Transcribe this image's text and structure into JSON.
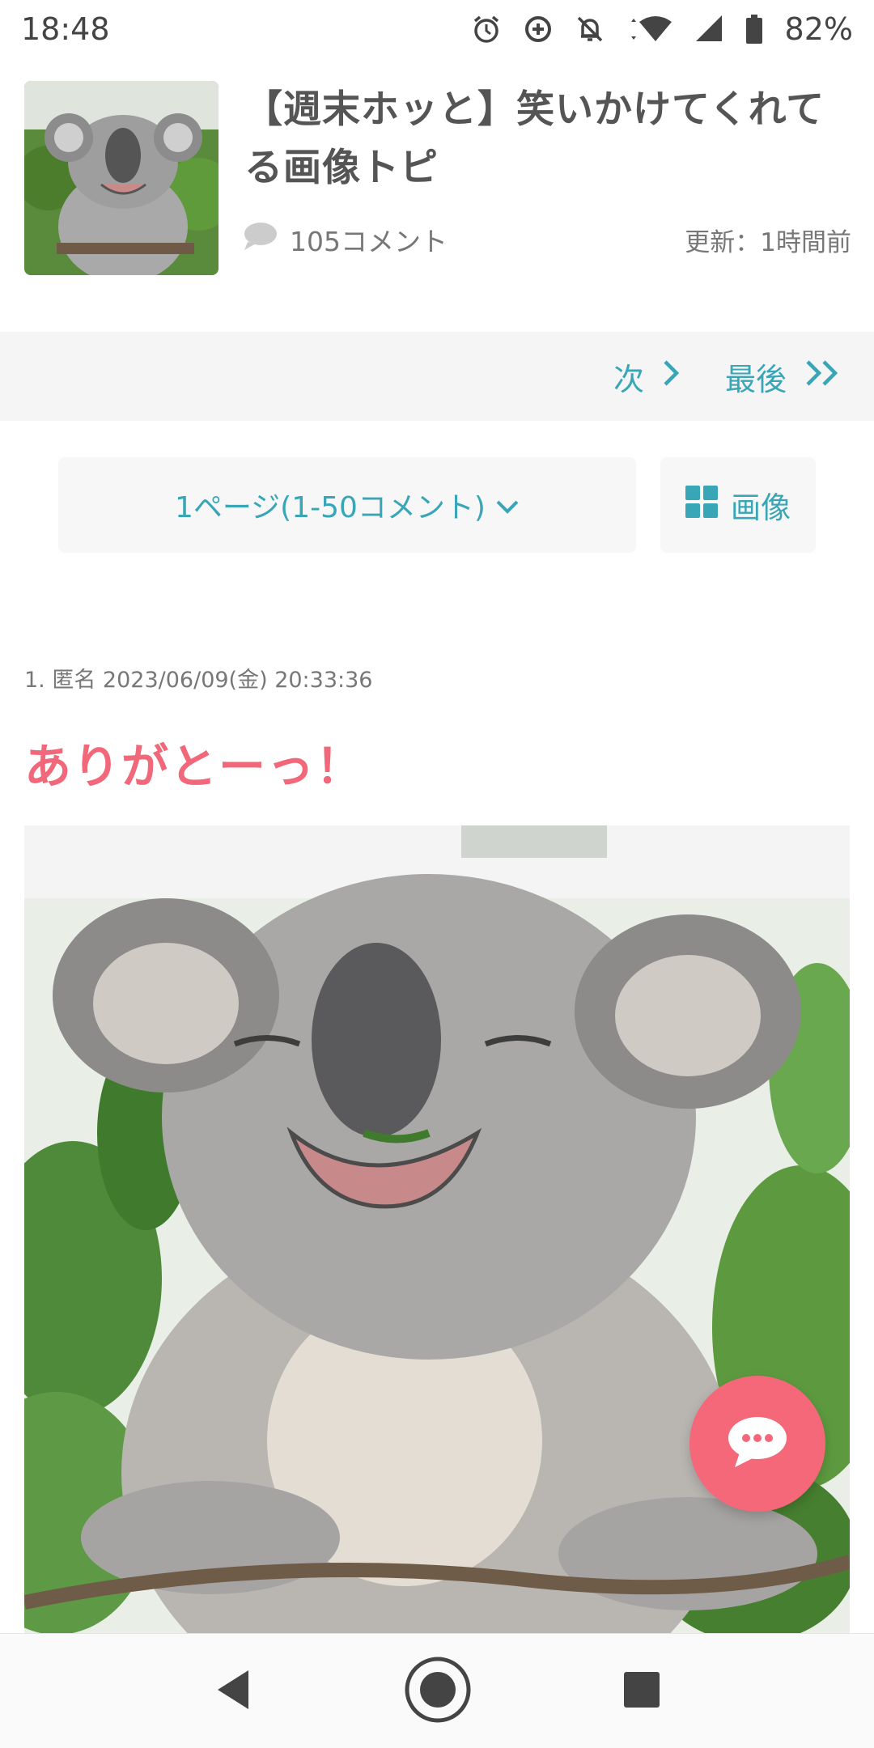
{
  "status_bar": {
    "time": "18:48",
    "battery": "82%",
    "icons": [
      "alarm-icon",
      "data-saver-icon",
      "mute-icon",
      "wifi-icon",
      "signal-icon",
      "battery-icon"
    ]
  },
  "topic": {
    "title": "【週末ホッと】笑いかけてくれてる画像トピ",
    "comment_count": "105コメント",
    "updated": "更新：1時間前"
  },
  "pagination": {
    "next_label": "次",
    "last_label": "最後"
  },
  "page_selector": {
    "label": "1ページ(1-50コメント)",
    "images_label": "画像"
  },
  "comment": {
    "meta": "1. 匿名 2023/06/09(金) 20:33:36",
    "body": "ありがとーっ！"
  },
  "colors": {
    "accent": "#39a6b7",
    "pink": "#f0687a"
  }
}
